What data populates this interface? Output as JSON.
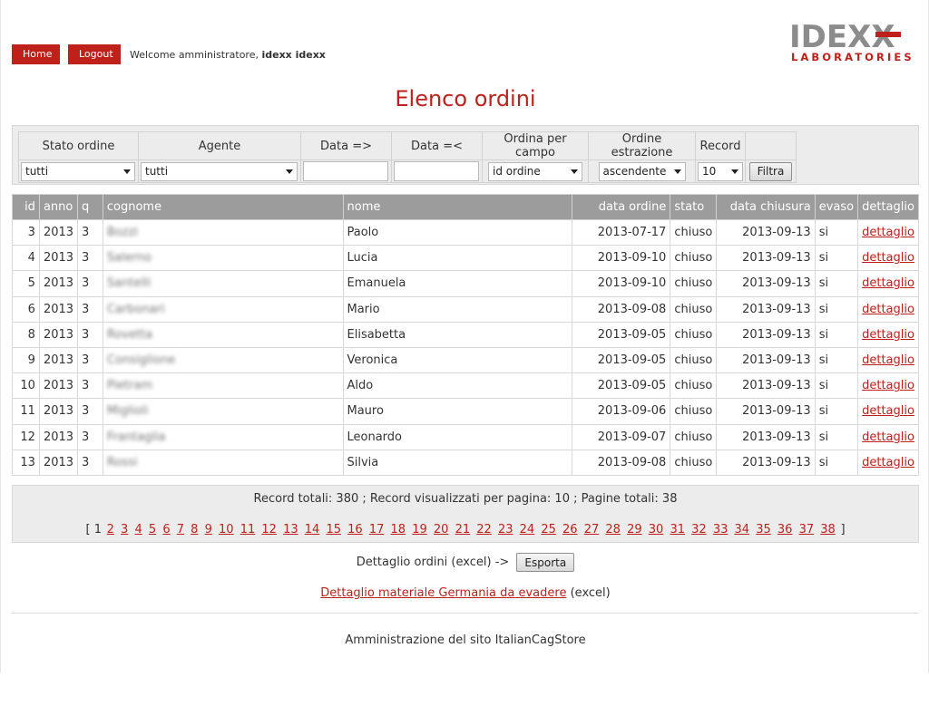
{
  "nav": {
    "home_label": "Home",
    "logout_label": "Logout",
    "welcome_prefix": "Welcome amministratore, ",
    "welcome_user": "idexx idexx"
  },
  "logo": {
    "word": "IDEXX",
    "sub": "LABORATORIES"
  },
  "page_title": "Elenco ordini",
  "filters": {
    "headers": [
      "Stato ordine",
      "Agente",
      "Data =>",
      "Data =<",
      "Ordina per campo",
      "Ordine estrazione",
      "Record"
    ],
    "stato_value": "tutti",
    "agente_value": "tutti",
    "data_from": "",
    "data_to": "",
    "ordina_value": "id ordine",
    "ordine_value": "ascendente",
    "record_value": "10",
    "button": "Filtra"
  },
  "table": {
    "columns": [
      "id",
      "anno",
      "q",
      "cognome",
      "nome",
      "data ordine",
      "stato",
      "data chiusura",
      "evaso",
      "dettaglio"
    ],
    "rows": [
      {
        "id": "3",
        "anno": "2013",
        "q": "3",
        "cognome": "Bozzi",
        "nome": "Paolo",
        "data_ordine": "2013-07-17",
        "stato": "chiuso",
        "data_chiusura": "2013-09-13",
        "evaso": "si",
        "dettaglio": "dettaglio"
      },
      {
        "id": "4",
        "anno": "2013",
        "q": "3",
        "cognome": "Salerno",
        "nome": "Lucia",
        "data_ordine": "2013-09-10",
        "stato": "chiuso",
        "data_chiusura": "2013-09-13",
        "evaso": "si",
        "dettaglio": "dettaglio"
      },
      {
        "id": "5",
        "anno": "2013",
        "q": "3",
        "cognome": "Santelli",
        "nome": "Emanuela",
        "data_ordine": "2013-09-10",
        "stato": "chiuso",
        "data_chiusura": "2013-09-13",
        "evaso": "si",
        "dettaglio": "dettaglio"
      },
      {
        "id": "6",
        "anno": "2013",
        "q": "3",
        "cognome": "Carbonari",
        "nome": "Mario",
        "data_ordine": "2013-09-08",
        "stato": "chiuso",
        "data_chiusura": "2013-09-13",
        "evaso": "si",
        "dettaglio": "dettaglio"
      },
      {
        "id": "8",
        "anno": "2013",
        "q": "3",
        "cognome": "Rovetta",
        "nome": "Elisabetta",
        "data_ordine": "2013-09-05",
        "stato": "chiuso",
        "data_chiusura": "2013-09-13",
        "evaso": "si",
        "dettaglio": "dettaglio"
      },
      {
        "id": "9",
        "anno": "2013",
        "q": "3",
        "cognome": "Consiglione",
        "nome": "Veronica",
        "data_ordine": "2013-09-05",
        "stato": "chiuso",
        "data_chiusura": "2013-09-13",
        "evaso": "si",
        "dettaglio": "dettaglio"
      },
      {
        "id": "10",
        "anno": "2013",
        "q": "3",
        "cognome": "Pietram",
        "nome": "Aldo",
        "data_ordine": "2013-09-05",
        "stato": "chiuso",
        "data_chiusura": "2013-09-13",
        "evaso": "si",
        "dettaglio": "dettaglio"
      },
      {
        "id": "11",
        "anno": "2013",
        "q": "3",
        "cognome": "Miglioli",
        "nome": "Mauro",
        "data_ordine": "2013-09-06",
        "stato": "chiuso",
        "data_chiusura": "2013-09-13",
        "evaso": "si",
        "dettaglio": "dettaglio"
      },
      {
        "id": "12",
        "anno": "2013",
        "q": "3",
        "cognome": "Frantaglia",
        "nome": "Leonardo",
        "data_ordine": "2013-09-07",
        "stato": "chiuso",
        "data_chiusura": "2013-09-13",
        "evaso": "si",
        "dettaglio": "dettaglio"
      },
      {
        "id": "13",
        "anno": "2013",
        "q": "3",
        "cognome": "Rossi",
        "nome": "Silvia",
        "data_ordine": "2013-09-08",
        "stato": "chiuso",
        "data_chiusura": "2013-09-13",
        "evaso": "si",
        "dettaglio": "dettaglio"
      }
    ]
  },
  "pager": {
    "summary": "Record totali: 380 ; Record visualizzati per pagina: 10 ; Pagine totali: 38",
    "current_page": "1",
    "total_pages": 38,
    "open_bracket": "[",
    "close_bracket": "]"
  },
  "export": {
    "label": "Dettaglio ordini (excel) ->",
    "button": "Esporta",
    "germania_link": "Dettaglio materiale Germania da evadere",
    "germania_suffix": " (excel)"
  },
  "footer": "Amministrazione del sito ItalianCagStore",
  "colors": {
    "accent": "#c0201a",
    "header_grey": "#9c9c9c",
    "panel_grey": "#ececec"
  }
}
